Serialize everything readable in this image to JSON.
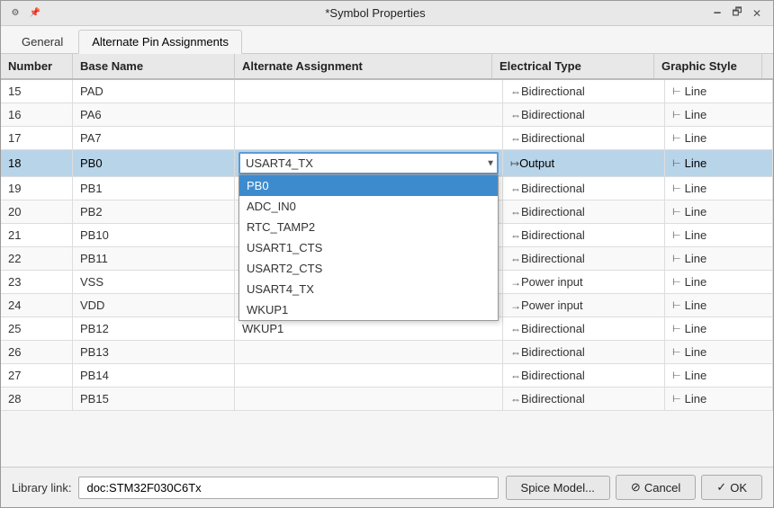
{
  "titlebar": {
    "title": "*Symbol Properties",
    "minimize": "🗕",
    "restore": "🗗",
    "close": "✕"
  },
  "tabs": [
    {
      "id": "general",
      "label": "General",
      "active": false
    },
    {
      "id": "alternate-pin",
      "label": "Alternate Pin Assignments",
      "active": true
    }
  ],
  "table": {
    "headers": [
      "Number",
      "Base Name",
      "Alternate Assignment",
      "Electrical Type",
      "Graphic Style"
    ],
    "rows": [
      {
        "number": "15",
        "baseName": "PAD",
        "altAssign": "",
        "elecType": "Bidirectional",
        "graphicStyle": "Line",
        "selected": false
      },
      {
        "number": "16",
        "baseName": "PA6",
        "altAssign": "",
        "elecType": "Bidirectional",
        "graphicStyle": "Line",
        "selected": false
      },
      {
        "number": "17",
        "baseName": "PA7",
        "altAssign": "",
        "elecType": "Bidirectional",
        "graphicStyle": "Line",
        "selected": false
      },
      {
        "number": "18",
        "baseName": "PB0",
        "altAssign": "USART4_TX",
        "elecType": "Output",
        "graphicStyle": "Line",
        "selected": true,
        "hasDropdown": true
      },
      {
        "number": "19",
        "baseName": "PB1",
        "altAssign": "PB0",
        "elecType": "Bidirectional",
        "graphicStyle": "Line",
        "selected": false,
        "dropdownHighlight": true
      },
      {
        "number": "20",
        "baseName": "PB2",
        "altAssign": "ADC_IN0",
        "elecType": "Bidirectional",
        "graphicStyle": "Line",
        "selected": false
      },
      {
        "number": "21",
        "baseName": "PB10",
        "altAssign": "RTC_TAMP2",
        "elecType": "Bidirectional",
        "graphicStyle": "Line",
        "selected": false
      },
      {
        "number": "22",
        "baseName": "PB11",
        "altAssign": "USART1_CTS",
        "elecType": "Bidirectional",
        "graphicStyle": "Line",
        "selected": false
      },
      {
        "number": "23",
        "baseName": "VSS",
        "altAssign": "USART2_CTS",
        "elecType": "Power input",
        "graphicStyle": "Line",
        "selected": false
      },
      {
        "number": "24",
        "baseName": "VDD",
        "altAssign": "USART4_TX",
        "elecType": "Power input",
        "graphicStyle": "Line",
        "selected": false
      },
      {
        "number": "25",
        "baseName": "PB12",
        "altAssign": "WKUP1",
        "elecType": "Bidirectional",
        "graphicStyle": "Line",
        "selected": false
      },
      {
        "number": "26",
        "baseName": "PB13",
        "altAssign": "",
        "elecType": "Bidirectional",
        "graphicStyle": "Line",
        "selected": false
      },
      {
        "number": "27",
        "baseName": "PB14",
        "altAssign": "",
        "elecType": "Bidirectional",
        "graphicStyle": "Line",
        "selected": false
      },
      {
        "number": "28",
        "baseName": "PB15",
        "altAssign": "",
        "elecType": "Bidirectional",
        "graphicStyle": "Line",
        "selected": false
      }
    ],
    "dropdown": {
      "items": [
        "PB0",
        "ADC_IN0",
        "RTC_TAMP2",
        "USART1_CTS",
        "USART2_CTS",
        "USART4_TX",
        "WKUP1"
      ]
    }
  },
  "footer": {
    "libraryLabel": "Library link:",
    "libraryValue": "doc:STM32F030C6Tx",
    "spiceButton": "Spice Model...",
    "cancelButton": "Cancel",
    "okButton": "OK"
  },
  "icons": {
    "bidirectional": "⇔",
    "output": "↦",
    "powerInput": "→",
    "pinLine": "⊢"
  }
}
